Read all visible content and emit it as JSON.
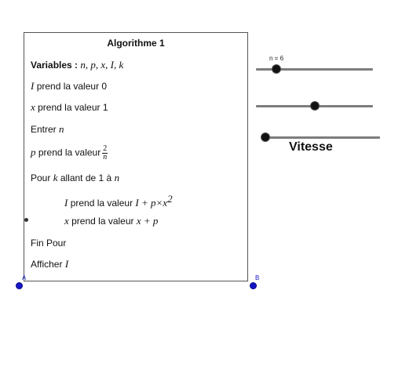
{
  "algorithm": {
    "title": "Algorithme 1",
    "variables_label": "Variables :",
    "variables_list": "n, p, x, I, k",
    "lines": [
      {
        "var": "I",
        "text": "prend la valeur 0"
      },
      {
        "var": "x",
        "text": "prend la valeur 1"
      },
      {
        "pre": "Entrer",
        "var": "n"
      },
      {
        "var": "p",
        "text": "prend la valeur",
        "frac_num": "2",
        "frac_den": "n"
      },
      {
        "pre": "Pour",
        "var": "k",
        "text": "allant de 1 à",
        "var2": "n"
      },
      {
        "var": "I",
        "text": "prend la valeur",
        "expr": "I + p×x",
        "exp": "2"
      },
      {
        "var": "x",
        "text": "prend la valeur",
        "expr": "x + p"
      },
      {
        "pre": "Fin Pour"
      },
      {
        "pre": "Afficher",
        "var": "I"
      }
    ]
  },
  "points": {
    "a_label": "A",
    "b_label": "B"
  },
  "sliders": {
    "n_label": "n = 6",
    "n_value": 6,
    "vitesse_label": "Vitesse"
  },
  "colors": {
    "point": "#1515c8",
    "knob": "#111111",
    "track": "#7d7d7d"
  }
}
